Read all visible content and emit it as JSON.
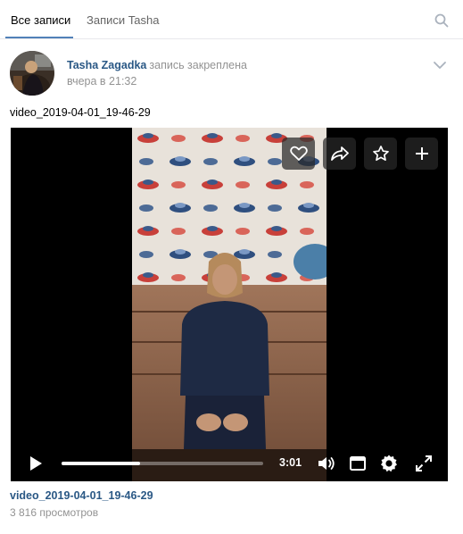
{
  "tabs": [
    {
      "label": "Все записи",
      "active": true
    },
    {
      "label": "Записи Tasha",
      "active": false
    }
  ],
  "post": {
    "author": "Tasha Zagadka",
    "pinned_text": "запись закреплена",
    "date": "вчера в 21:32",
    "text": "video_2019-04-01_19-46-29"
  },
  "video": {
    "duration": "3:01",
    "progress_fraction": 0.39,
    "title": "video_2019-04-01_19-46-29",
    "views": "3 816 просмотров"
  },
  "icons": [
    "search-icon",
    "chevron-down-icon",
    "heart-icon",
    "share-icon",
    "star-icon",
    "plus-icon",
    "play-icon",
    "volume-icon",
    "miniplayer-icon",
    "settings-icon",
    "fullscreen-icon"
  ],
  "colors": {
    "link": "#2a5885",
    "accent": "#5181b8",
    "muted": "#939393"
  }
}
